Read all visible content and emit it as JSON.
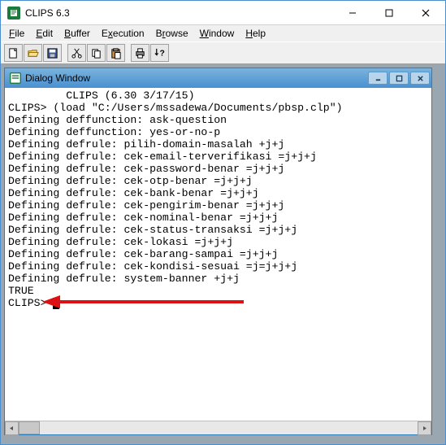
{
  "window": {
    "title": "CLIPS 6.3"
  },
  "menubar": {
    "file": "File",
    "edit": "Edit",
    "buffer": "Buffer",
    "execution": "Execution",
    "browse": "Browse",
    "window": "Window",
    "help": "Help"
  },
  "toolbar": {
    "new": "new-file",
    "open": "open-file",
    "save": "save-file",
    "cut": "cut",
    "copy": "copy",
    "paste": "paste",
    "print": "print",
    "help": "context-help"
  },
  "mdi": {
    "title": "Dialog Window"
  },
  "console": {
    "lines": [
      "         CLIPS (6.30 3/17/15)",
      "CLIPS> (load \"C:/Users/mssadewa/Documents/pbsp.clp\")",
      "Defining deffunction: ask-question",
      "Defining deffunction: yes-or-no-p",
      "Defining defrule: pilih-domain-masalah +j+j",
      "Defining defrule: cek-email-terverifikasi =j+j+j",
      "Defining defrule: cek-password-benar =j+j+j",
      "Defining defrule: cek-otp-benar =j+j+j",
      "Defining defrule: cek-bank-benar =j+j+j",
      "Defining defrule: cek-pengirim-benar =j+j+j",
      "Defining defrule: cek-nominal-benar =j+j+j",
      "Defining defrule: cek-status-transaksi =j+j+j",
      "Defining defrule: cek-lokasi =j+j+j",
      "Defining defrule: cek-barang-sampai =j+j+j",
      "Defining defrule: cek-kondisi-sesuai =j=j+j+j",
      "Defining defrule: system-banner +j+j",
      "TRUE"
    ],
    "prompt": "CLIPS>"
  }
}
